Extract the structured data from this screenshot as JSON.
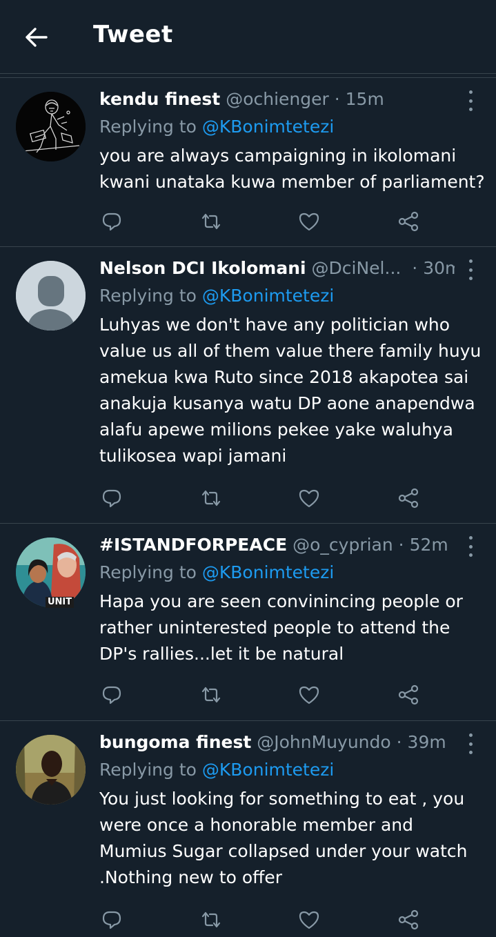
{
  "header": {
    "title": "Tweet"
  },
  "colors": {
    "background": "#15202b",
    "divider": "#38444d",
    "secondary_text": "#8899a6",
    "link": "#1d9bf0",
    "primary_text": "#ffffff"
  },
  "tweets": [
    {
      "name": "kendu finest",
      "handle": "@ochienger",
      "dot": "·",
      "time": "15m",
      "replying_prefix": "Replying to ",
      "replying_to": "@KBonimtetezi",
      "text": "you are always campaigning in ikolomani kwani unataka kuwa member of parliament?",
      "avatar_icon": "dark-sketch-avatar"
    },
    {
      "name": "Nelson DCI Ikolomani",
      "handle": "@DciNel...",
      "dot": "·",
      "time": "30m",
      "replying_prefix": "Replying to ",
      "replying_to": "@KBonimtetezi",
      "text": "Luhyas we don't have any politician who value us all of them value there family huyu amekua kwa Ruto since 2018 akapotea sai anakuja kusanya watu DP aone anapendwa alafu apewe milions pekee yake waluhya tulikosea wapi jamani",
      "avatar_icon": "default-profile-avatar"
    },
    {
      "name": "#ISTANDFORPEACE",
      "handle": "@o_cyprian",
      "dot": "·",
      "time": "52m",
      "replying_prefix": "Replying to ",
      "replying_to": "@KBonimtetezi",
      "text": "Hapa you are seen convinincing people or rather uninterested people to attend the DP's rallies...let it be natural",
      "avatar_label": "UNIT",
      "avatar_icon": "painted-portrait-avatar"
    },
    {
      "name": "bungoma finest",
      "handle": "@JohnMuyundo",
      "dot": "·",
      "time": "39m",
      "replying_prefix": "Replying to ",
      "replying_to": "@KBonimtetezi",
      "text": "You just looking for something to eat , you were once a honorable member and Mumius Sugar collapsed under your watch .Nothing new to offer",
      "avatar_icon": "photo-portrait-avatar"
    }
  ],
  "action_icons": [
    "reply-icon",
    "retweet-icon",
    "like-icon",
    "share-icon"
  ]
}
